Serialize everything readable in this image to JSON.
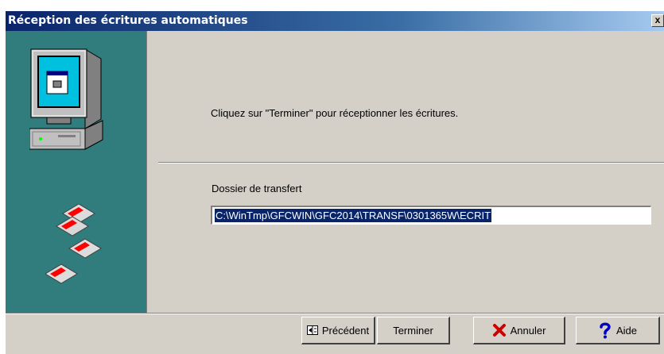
{
  "window": {
    "title": "Réception des écritures automatiques",
    "close_label": "x"
  },
  "content": {
    "instruction": "Cliquez sur \"Terminer\"  pour  réceptionner les écritures.",
    "folder_label": "Dossier de transfert",
    "folder_value": "C:\\WinTmp\\GFCWIN\\GFC2014\\TRANSF\\0301365W\\ECRIT"
  },
  "buttons": {
    "previous": "Précédent",
    "finish": "Terminer",
    "cancel": "Annuler",
    "help": "Aide"
  },
  "icons": {
    "side_panel": [
      "computer-icon",
      "floppy-disks-icon"
    ],
    "buttons": [
      "previous-arrow-icon",
      "cancel-x-icon",
      "help-question-icon"
    ]
  },
  "colors": {
    "title_bar": "#0a246a",
    "side_panel": "#317c7c",
    "dialog_face": "#d4d0c8",
    "selection": "#0a246a"
  }
}
